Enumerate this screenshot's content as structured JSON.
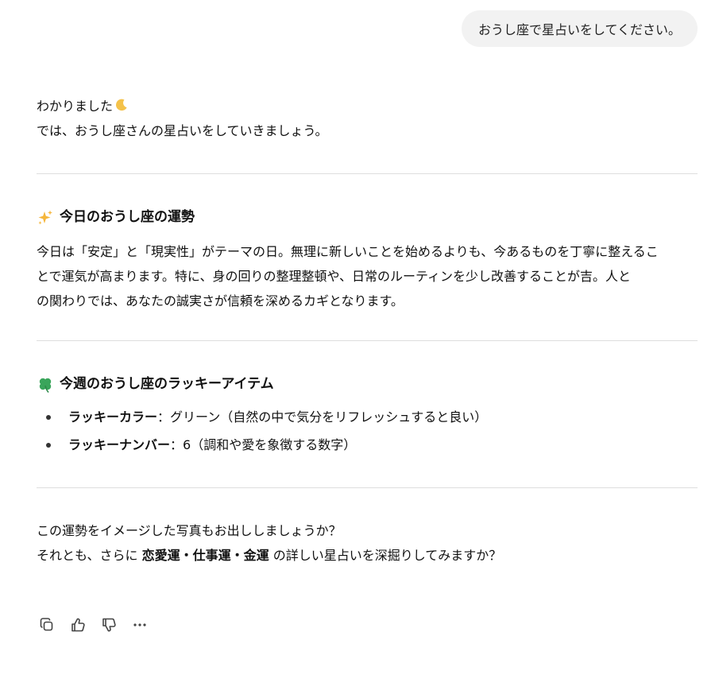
{
  "user_message": "おうし座で星占いをしてください。",
  "assistant": {
    "intro_line1": "わかりました",
    "intro_line2": "では、おうし座さんの星占いをしていきましょう。",
    "intro_icon": "crescent-moon-icon",
    "section1": {
      "icon": "sparkles-icon",
      "title": "今日のおうし座の運勢",
      "lines": [
        "今日は「安定」と「現実性」がテーマの日。無理に新しいことを始めるよりも、今あるものを丁寧に整えるこ",
        "とで運気が高まります。特に、身の回りの整理整頓や、日常のルーティンを少し改善することが吉。人と",
        "の関わりでは、あなたの誠実さが信頼を深めるカギとなります。"
      ]
    },
    "section2": {
      "icon": "four-leaf-clover-icon",
      "title": "今週のおうし座のラッキーアイテム",
      "items": [
        {
          "label": "ラッキーカラー",
          "value": "：グリーン（自然の中で気分をリフレッシュすると良い）"
        },
        {
          "label": "ラッキーナンバー",
          "value": "：6（調和や愛を象徴する数字）"
        }
      ]
    },
    "closing_line1": "この運勢をイメージした写真もお出ししましょうか？",
    "closing_line2_prefix": "それとも、さらに ",
    "closing_line2_bold": "恋愛運・仕事運・金運",
    "closing_line2_suffix": " の詳しい星占いを深掘りしてみますか？"
  },
  "actions": [
    "copy-icon",
    "thumbs-up-icon",
    "thumbs-down-icon",
    "more-icon"
  ],
  "colors": {
    "user_bubble": "#f2f2f2",
    "divider": "#dedede",
    "text": "#111111",
    "icon": "#444444",
    "clover": "#3aa55b",
    "sparkle": "#f5b63c",
    "moon": "#f4c24a"
  }
}
